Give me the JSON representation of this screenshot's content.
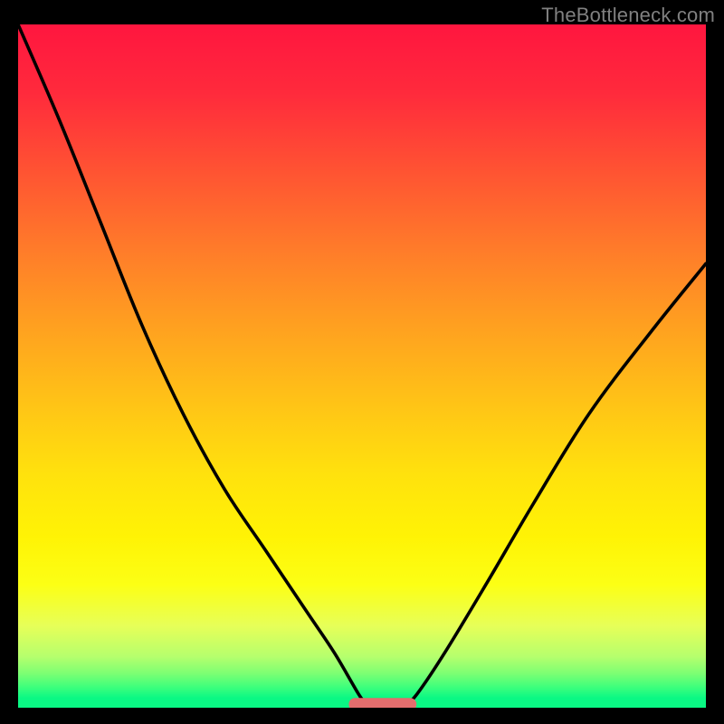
{
  "watermark": "TheBottleneck.com",
  "chart_data": {
    "type": "line",
    "title": "",
    "xlabel": "",
    "ylabel": "",
    "xlim": [
      0,
      100
    ],
    "ylim": [
      0,
      100
    ],
    "gradient_stops": [
      {
        "pos": 0,
        "color": "#ff163f"
      },
      {
        "pos": 10,
        "color": "#ff2a3c"
      },
      {
        "pos": 22,
        "color": "#ff5532"
      },
      {
        "pos": 34,
        "color": "#ff7f29"
      },
      {
        "pos": 45,
        "color": "#ffa31f"
      },
      {
        "pos": 56,
        "color": "#ffc516"
      },
      {
        "pos": 66,
        "color": "#ffe20d"
      },
      {
        "pos": 75,
        "color": "#fff305"
      },
      {
        "pos": 82,
        "color": "#fcff15"
      },
      {
        "pos": 88,
        "color": "#e7ff58"
      },
      {
        "pos": 92.5,
        "color": "#b6ff6d"
      },
      {
        "pos": 95,
        "color": "#7cff73"
      },
      {
        "pos": 97,
        "color": "#3dff7c"
      },
      {
        "pos": 98.6,
        "color": "#0af884"
      },
      {
        "pos": 100,
        "color": "#0af884"
      }
    ],
    "series": [
      {
        "name": "left-curve",
        "x": [
          0,
          6,
          12,
          18,
          24,
          30,
          36,
          42,
          46,
          49.5,
          51
        ],
        "y": [
          100,
          86,
          71,
          56,
          43,
          32,
          23,
          14,
          8,
          2,
          0
        ]
      },
      {
        "name": "right-curve",
        "x": [
          56,
          58,
          62,
          68,
          75,
          83,
          92,
          100
        ],
        "y": [
          0,
          2,
          8,
          18,
          30,
          43,
          55,
          65
        ]
      }
    ],
    "flat_segment": {
      "name": "bottom-flat-marker",
      "x_range": [
        49,
        57
      ],
      "y": 0.5,
      "color": "#e36d6d",
      "thickness_px": 14
    }
  }
}
